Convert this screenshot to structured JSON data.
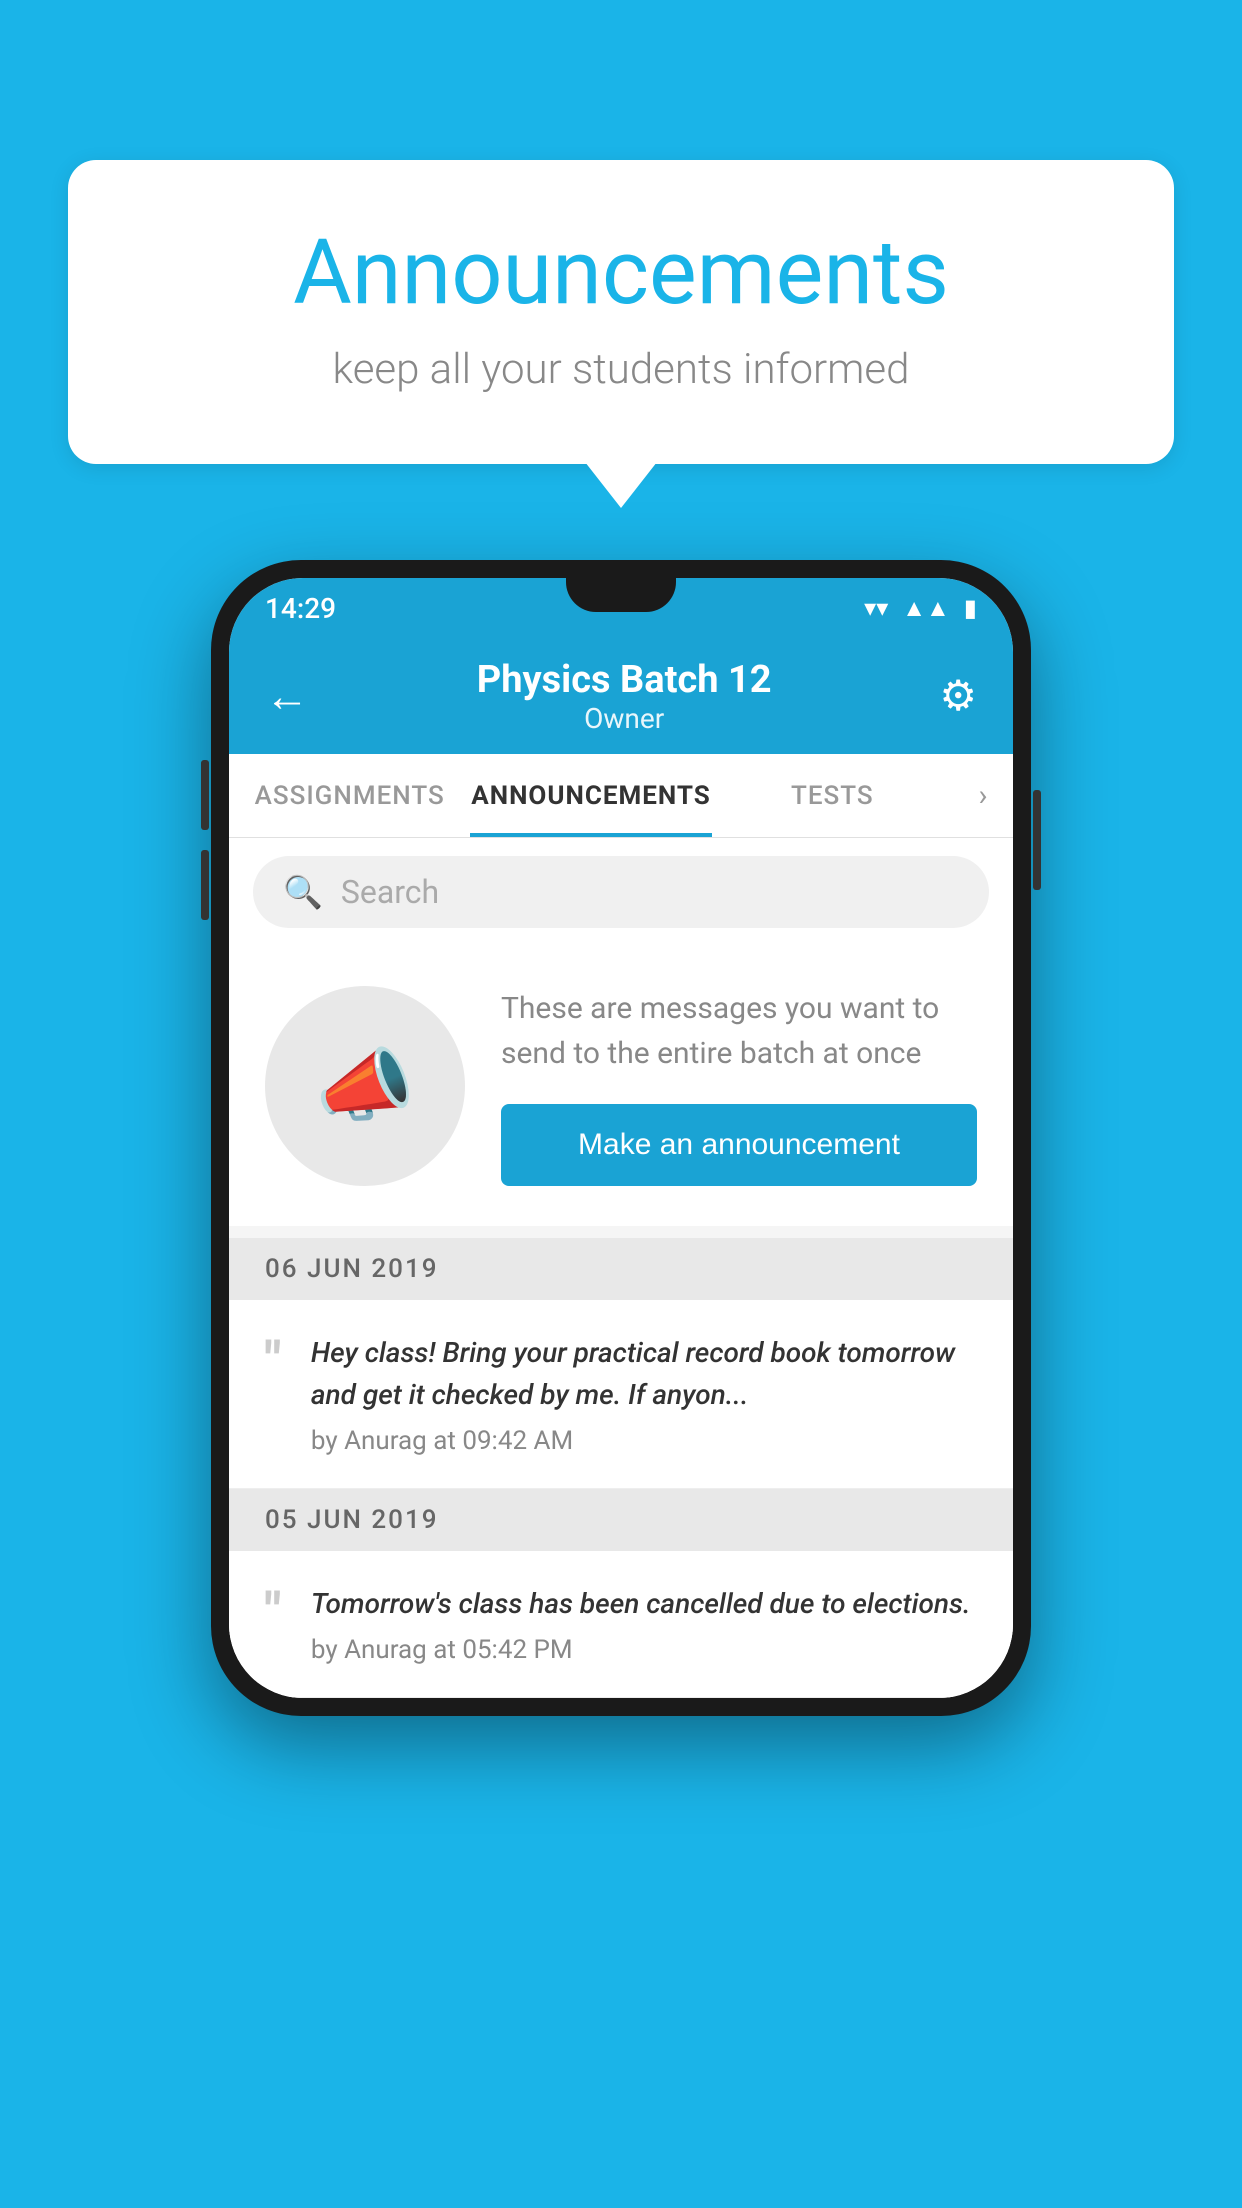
{
  "page": {
    "background_color": "#1ab4e8"
  },
  "speech_bubble": {
    "title": "Announcements",
    "subtitle": "keep all your students informed"
  },
  "phone": {
    "status_bar": {
      "time": "14:29"
    },
    "header": {
      "title": "Physics Batch 12",
      "subtitle": "Owner",
      "back_label": "←",
      "settings_label": "⚙"
    },
    "tabs": [
      {
        "label": "ASSIGNMENTS",
        "active": false
      },
      {
        "label": "ANNOUNCEMENTS",
        "active": true
      },
      {
        "label": "TESTS",
        "active": false
      }
    ],
    "search": {
      "placeholder": "Search"
    },
    "announcement_promo": {
      "description": "These are messages you want to send to the entire batch at once",
      "button_label": "Make an announcement"
    },
    "announcements": [
      {
        "date": "06  JUN  2019",
        "message": "Hey class! Bring your practical record book tomorrow and get it checked by me. If anyon...",
        "meta": "by Anurag at 09:42 AM"
      },
      {
        "date": "05  JUN  2019",
        "message": "Tomorrow's class has been cancelled due to elections.",
        "meta": "by Anurag at 05:42 PM"
      }
    ]
  }
}
